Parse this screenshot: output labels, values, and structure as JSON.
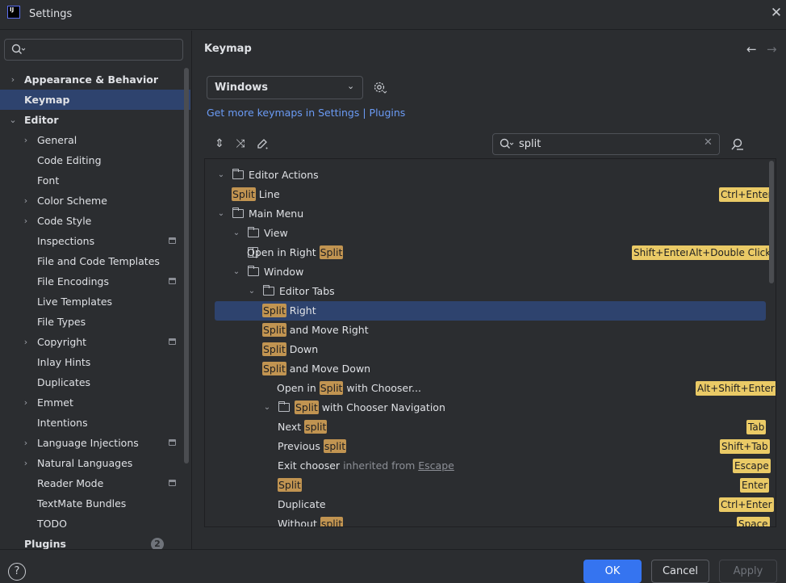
{
  "window": {
    "title": "Settings",
    "logo_text": "IJ",
    "close": "✕"
  },
  "sidebar": {
    "search_placeholder": "",
    "items": [
      {
        "label": "Appearance & Behavior",
        "chev": "›",
        "level": 0,
        "bold": true
      },
      {
        "label": "Keymap",
        "chev": "",
        "level": 0,
        "bold": true,
        "selected": true
      },
      {
        "label": "Editor",
        "chev": "⌄",
        "level": 0,
        "bold": true
      },
      {
        "label": "General",
        "chev": "›",
        "level": 1
      },
      {
        "label": "Code Editing",
        "chev": "",
        "level": 1
      },
      {
        "label": "Font",
        "chev": "",
        "level": 1
      },
      {
        "label": "Color Scheme",
        "chev": "›",
        "level": 1
      },
      {
        "label": "Code Style",
        "chev": "›",
        "level": 1
      },
      {
        "label": "Inspections",
        "chev": "",
        "level": 1,
        "project": true
      },
      {
        "label": "File and Code Templates",
        "chev": "",
        "level": 1
      },
      {
        "label": "File Encodings",
        "chev": "",
        "level": 1,
        "project": true
      },
      {
        "label": "Live Templates",
        "chev": "",
        "level": 1
      },
      {
        "label": "File Types",
        "chev": "",
        "level": 1
      },
      {
        "label": "Copyright",
        "chev": "›",
        "level": 1,
        "project": true
      },
      {
        "label": "Inlay Hints",
        "chev": "",
        "level": 1
      },
      {
        "label": "Duplicates",
        "chev": "",
        "level": 1
      },
      {
        "label": "Emmet",
        "chev": "›",
        "level": 1
      },
      {
        "label": "Intentions",
        "chev": "",
        "level": 1
      },
      {
        "label": "Language Injections",
        "chev": "›",
        "level": 1,
        "project": true
      },
      {
        "label": "Natural Languages",
        "chev": "›",
        "level": 1
      },
      {
        "label": "Reader Mode",
        "chev": "",
        "level": 1,
        "project": true
      },
      {
        "label": "TextMate Bundles",
        "chev": "",
        "level": 1
      },
      {
        "label": "TODO",
        "chev": "",
        "level": 1
      },
      {
        "label": "Plugins",
        "chev": "",
        "level": 0,
        "bold": true,
        "badge": "2"
      }
    ]
  },
  "main": {
    "title": "Keymap",
    "keymap_value": "Windows",
    "more_link": "Get more keymaps in Settings | Plugins",
    "filter_value": "split",
    "actions": [
      {
        "level": 0,
        "chev": "⌄",
        "icon": "folder",
        "parts": [
          {
            "t": "Editor Actions"
          }
        ]
      },
      {
        "level": 1,
        "chev": "",
        "icon": "",
        "parts": [
          {
            "t": "Split",
            "h": true
          },
          {
            "t": " Line"
          }
        ],
        "shortcuts": [
          "Ctrl+Enter"
        ]
      },
      {
        "level": 0,
        "chev": "⌄",
        "icon": "folder",
        "parts": [
          {
            "t": "Main Menu"
          }
        ]
      },
      {
        "level": 1,
        "chev": "⌄",
        "icon": "folder",
        "parts": [
          {
            "t": "View"
          }
        ]
      },
      {
        "level": 2,
        "chev": "",
        "icon": "vsplit",
        "parts": [
          {
            "t": "Open in Right "
          },
          {
            "t": "Split",
            "h": true
          }
        ],
        "shortcuts": [
          "Shift+Enter",
          "Alt+Double Click"
        ]
      },
      {
        "level": 1,
        "chev": "⌄",
        "icon": "folder",
        "parts": [
          {
            "t": "Window"
          }
        ]
      },
      {
        "level": 2,
        "chev": "⌄",
        "icon": "folder",
        "parts": [
          {
            "t": "Editor Tabs"
          }
        ]
      },
      {
        "level": 3,
        "chev": "",
        "icon": "vsplit",
        "parts": [
          {
            "t": "Split",
            "h": true
          },
          {
            "t": " Right"
          }
        ],
        "selected": true
      },
      {
        "level": 3,
        "chev": "",
        "icon": "",
        "parts": [
          {
            "t": "Split",
            "h": true
          },
          {
            "t": " and Move Right"
          }
        ]
      },
      {
        "level": 3,
        "chev": "",
        "icon": "hsplit",
        "parts": [
          {
            "t": "Split",
            "h": true
          },
          {
            "t": " Down"
          }
        ]
      },
      {
        "level": 3,
        "chev": "",
        "icon": "",
        "parts": [
          {
            "t": "Split",
            "h": true
          },
          {
            "t": " and Move Down"
          }
        ]
      },
      {
        "level": 3,
        "chev": "",
        "icon": "none",
        "parts": [
          {
            "t": "Open in "
          },
          {
            "t": "Split",
            "h": true
          },
          {
            "t": " with Chooser..."
          }
        ],
        "shortcuts": [
          "Alt+Shift+Enter"
        ]
      },
      {
        "level": 3,
        "chev": "⌄",
        "icon": "folder",
        "parts": [
          {
            "t": "Split",
            "h": true
          },
          {
            "t": " with Chooser Navigation"
          }
        ]
      },
      {
        "level": 4,
        "chev": "",
        "icon": "",
        "parts": [
          {
            "t": "Next "
          },
          {
            "t": "split",
            "h": true
          }
        ],
        "shortcuts": [
          "Tab"
        ]
      },
      {
        "level": 4,
        "chev": "",
        "icon": "",
        "parts": [
          {
            "t": "Previous "
          },
          {
            "t": "split",
            "h": true
          }
        ],
        "shortcuts": [
          "Shift+Tab"
        ]
      },
      {
        "level": 4,
        "chev": "",
        "icon": "",
        "parts": [
          {
            "t": "Exit chooser "
          },
          {
            "t": "inherited from ",
            "c": "inh"
          },
          {
            "t": "Escape",
            "c": "esc"
          }
        ],
        "shortcuts": [
          "Escape"
        ]
      },
      {
        "level": 4,
        "chev": "",
        "icon": "",
        "parts": [
          {
            "t": "Split",
            "h": true
          }
        ],
        "shortcuts": [
          "Enter"
        ]
      },
      {
        "level": 4,
        "chev": "",
        "icon": "",
        "parts": [
          {
            "t": "Duplicate"
          }
        ],
        "shortcuts": [
          "Ctrl+Enter"
        ]
      },
      {
        "level": 4,
        "chev": "",
        "icon": "",
        "parts": [
          {
            "t": "Without "
          },
          {
            "t": "split",
            "h": true
          }
        ],
        "shortcuts": [
          "Space"
        ]
      }
    ]
  },
  "footer": {
    "help": "?",
    "ok": "OK",
    "cancel": "Cancel",
    "apply": "Apply"
  },
  "colors": {
    "accent": "#3574f0",
    "selection": "#2e436e",
    "highlight": "#c19451",
    "shortcut_bg": "#eaca66",
    "link": "#6b9bf5"
  },
  "icons": [
    "search-icon",
    "gear-icon",
    "expand-all-icon",
    "collapse-all-icon",
    "edit-icon",
    "find-shortcut-icon",
    "back-arrow-icon",
    "forward-arrow-icon",
    "folder-icon"
  ]
}
